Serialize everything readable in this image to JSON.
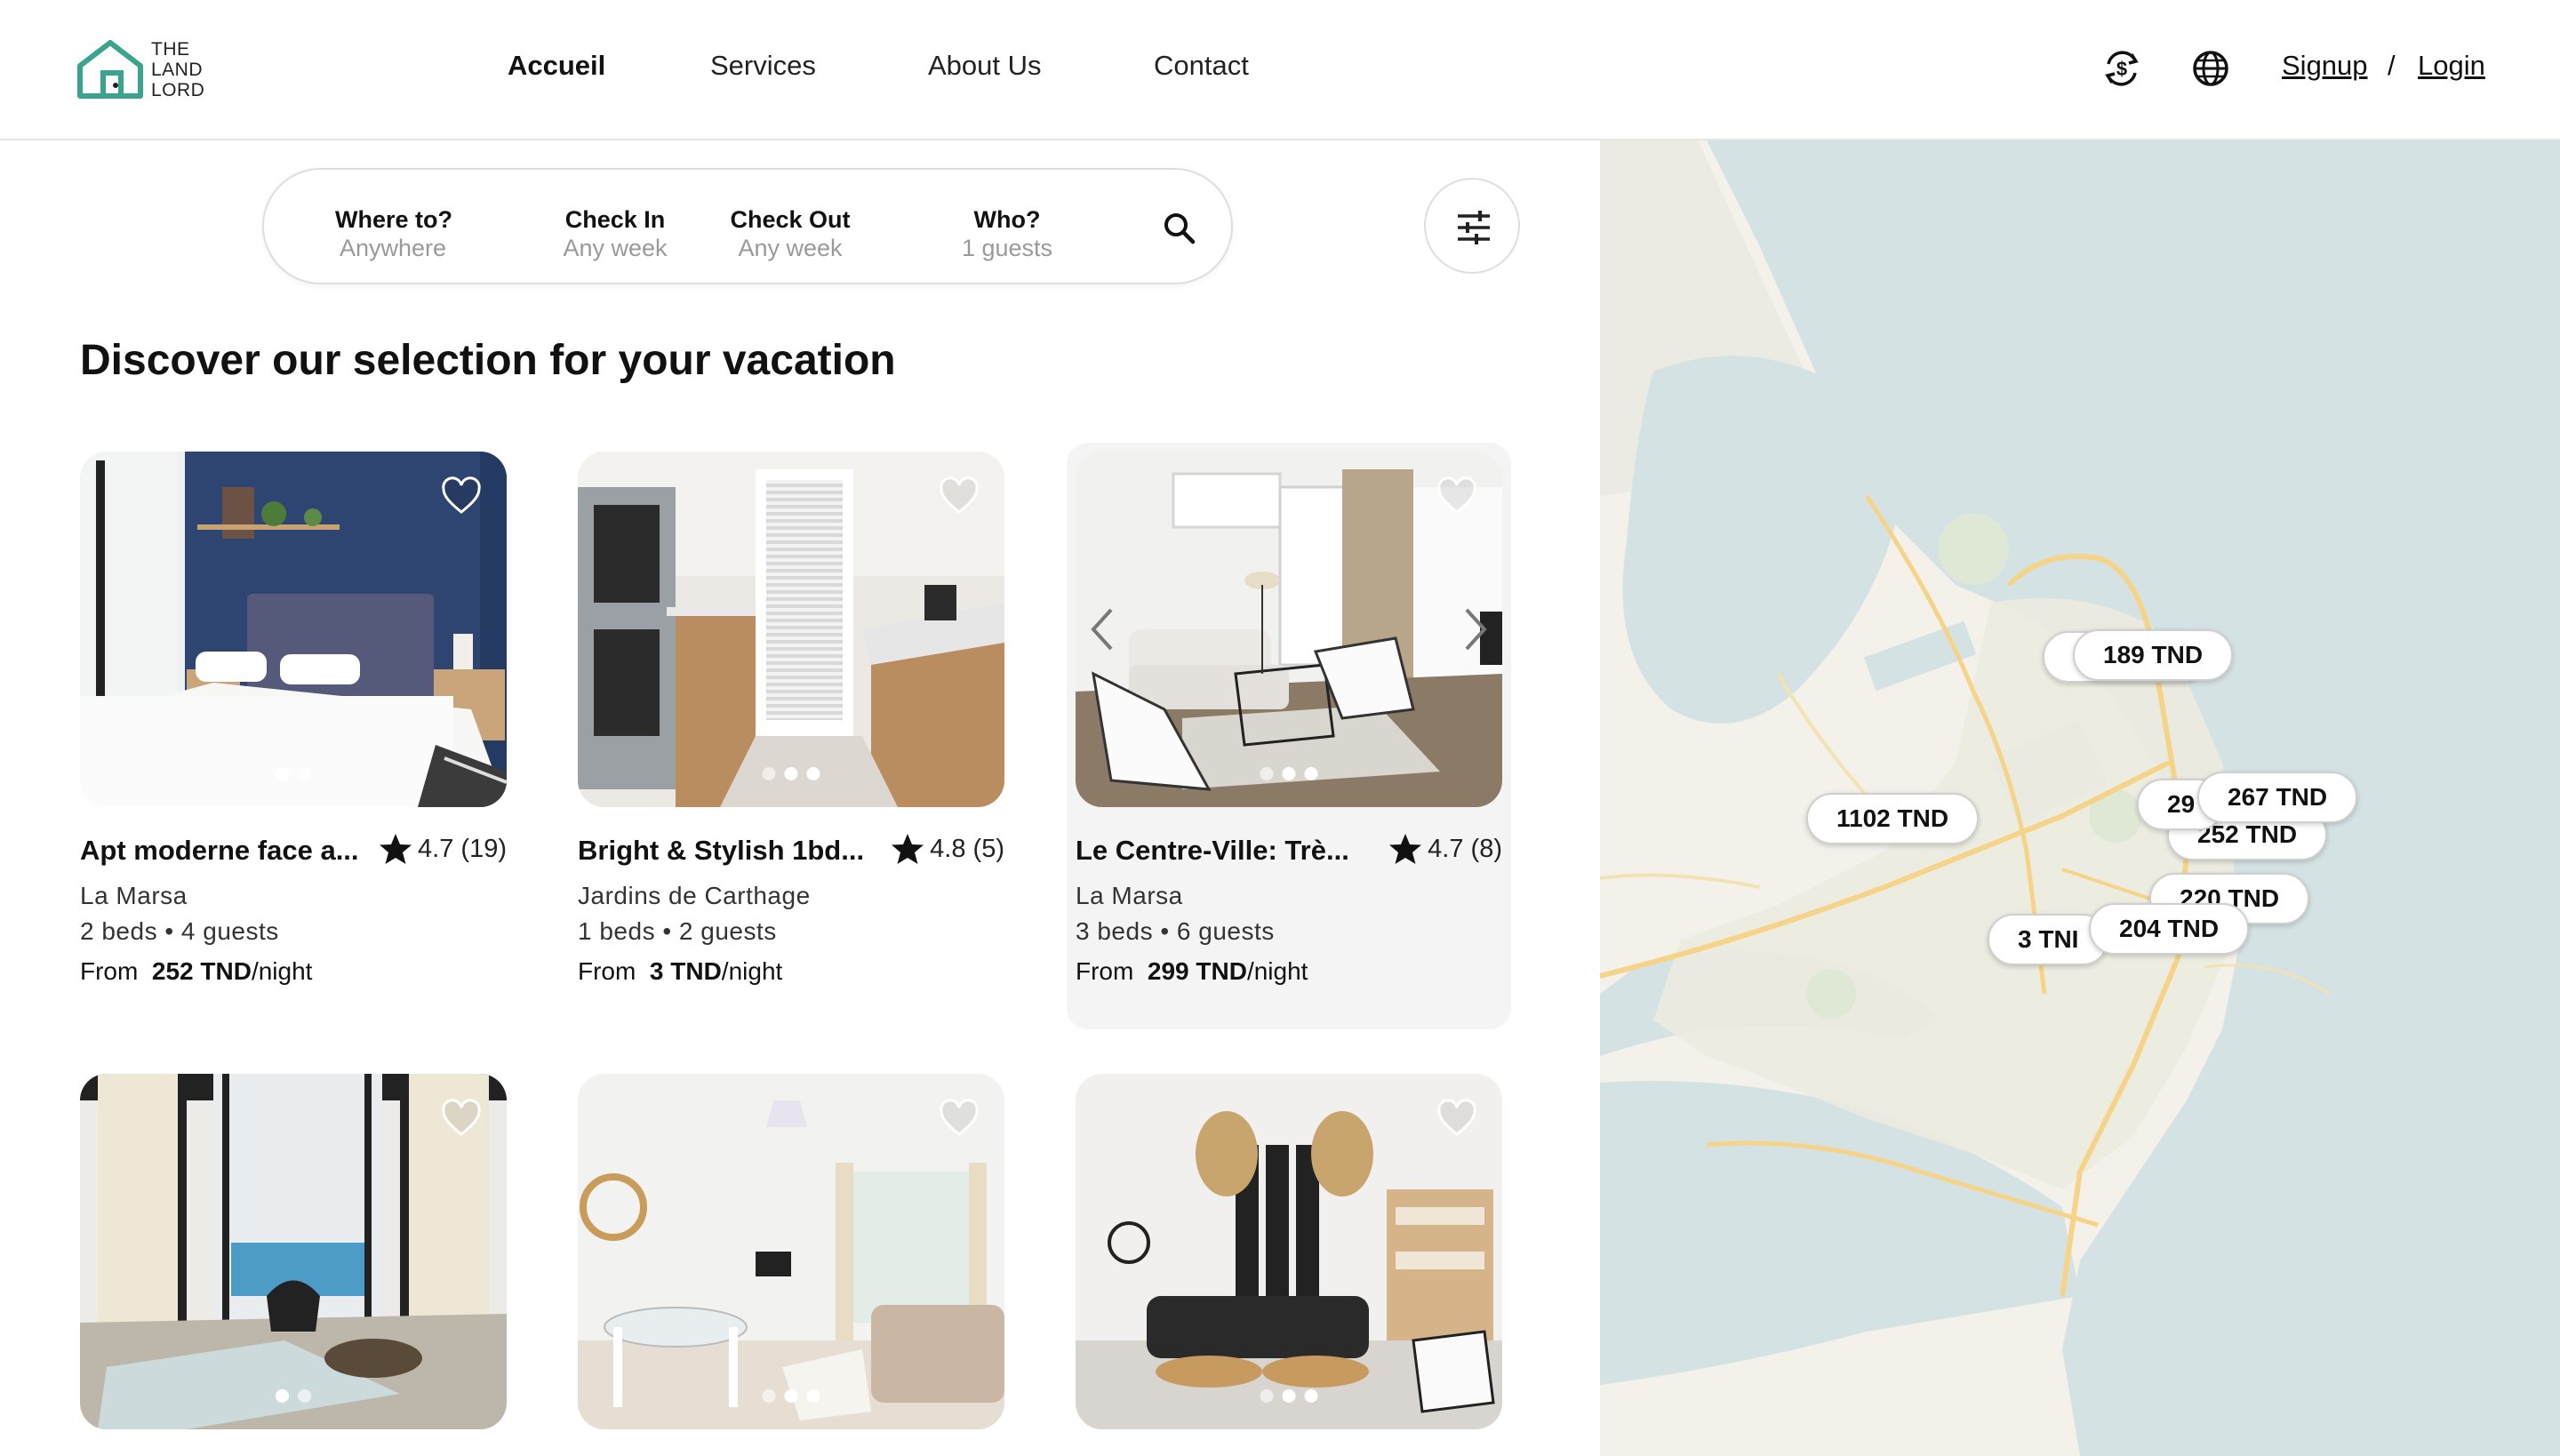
{
  "brand": {
    "line1": "THE",
    "line2": "LAND",
    "line3": "LORD",
    "accent": "#3aa58c"
  },
  "nav": [
    {
      "label": "Accueil",
      "active": true
    },
    {
      "label": "Services",
      "active": false
    },
    {
      "label": "About Us",
      "active": false
    },
    {
      "label": "Contact",
      "active": false
    }
  ],
  "header_actions": {
    "currency_icon": "currency-exchange-icon",
    "language_icon": "globe-icon",
    "signup": "Signup",
    "separator": "/",
    "login": "Login"
  },
  "search": {
    "where": {
      "label": "Where to?",
      "value": "Anywhere"
    },
    "checkin": {
      "label": "Check In",
      "value": "Any week"
    },
    "checkout": {
      "label": "Check Out",
      "value": "Any week"
    },
    "who": {
      "label": "Who?",
      "value": "1 guests"
    },
    "search_icon": "search-icon",
    "filter_icon": "sliders-icon"
  },
  "heading": "Discover our selection for your vacation",
  "listings": [
    {
      "title": "Apt moderne face a...",
      "rating": "4.7 (19)",
      "location": "La Marsa",
      "details": "2 beds • 4 guests",
      "price_prefix": "From",
      "price": "252 TND",
      "price_suffix": "/night"
    },
    {
      "title": "Bright & Stylish 1bd...",
      "rating": "4.8 (5)",
      "location": "Jardins de Carthage",
      "details": "1 beds • 2 guests",
      "price_prefix": "From",
      "price": "3 TND",
      "price_suffix": "/night"
    },
    {
      "title": "Le Centre-Ville: Trè...",
      "rating": "4.7 (8)",
      "location": "La Marsa",
      "details": "3 beds • 6 guests",
      "price_prefix": "From",
      "price": "299 TND",
      "price_suffix": "/night"
    }
  ],
  "map_pins": [
    {
      "label": "189 TND"
    },
    {
      "label": "1102 TND"
    },
    {
      "label": "29"
    },
    {
      "label": "267 TND"
    },
    {
      "label": "252 TND"
    },
    {
      "label": "220 TND"
    },
    {
      "label": "3 TNI"
    },
    {
      "label": "204 TND"
    }
  ]
}
